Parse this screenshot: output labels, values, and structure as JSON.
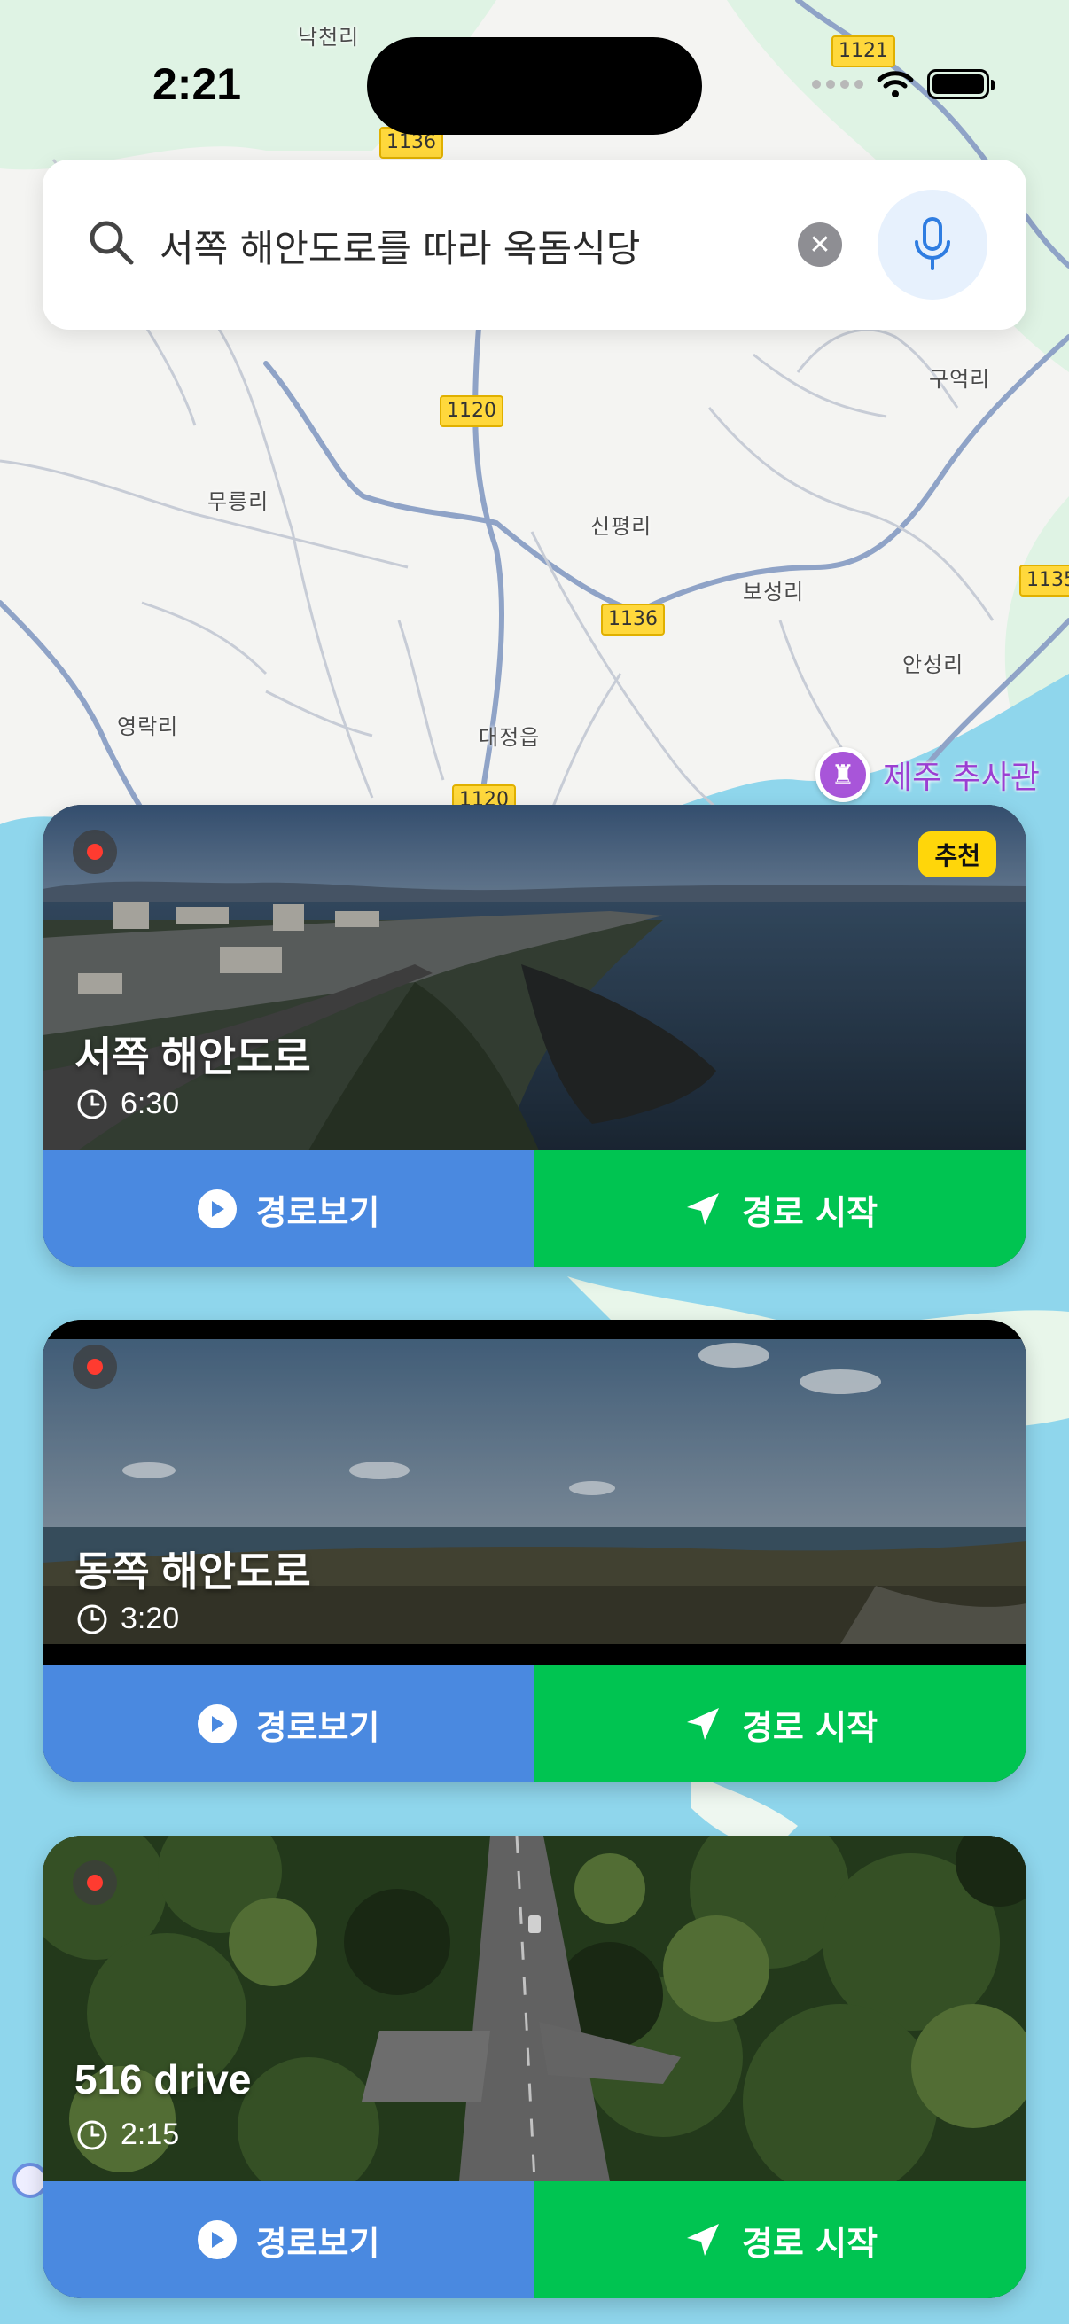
{
  "status": {
    "time": "2:21"
  },
  "search": {
    "query": "서쪽 해안도로를 따라 옥돔식당"
  },
  "map": {
    "places": [
      "낙천리",
      "구억리",
      "무릉리",
      "신평리",
      "보성리",
      "안성리",
      "영락리",
      "대정읍"
    ],
    "routes": [
      "1121",
      "1136",
      "1120",
      "1136",
      "1135",
      "1120"
    ],
    "poi": "제주 추사관",
    "poi_icon": "castle-icon"
  },
  "cards": [
    {
      "title": "서쪽 해안도로",
      "duration": "6:30",
      "badge": "추천",
      "view_label": "경로보기",
      "start_label": "경로 시작"
    },
    {
      "title": "동쪽 해안도로",
      "duration": "3:20",
      "view_label": "경로보기",
      "start_label": "경로 시작"
    },
    {
      "title": "516 drive",
      "duration": "2:15",
      "view_label": "경로보기",
      "start_label": "경로 시작"
    }
  ],
  "colors": {
    "view": "#4a89e0",
    "start": "#00c451",
    "sea": "#8fd6ec",
    "badge": "#ffd60a"
  }
}
